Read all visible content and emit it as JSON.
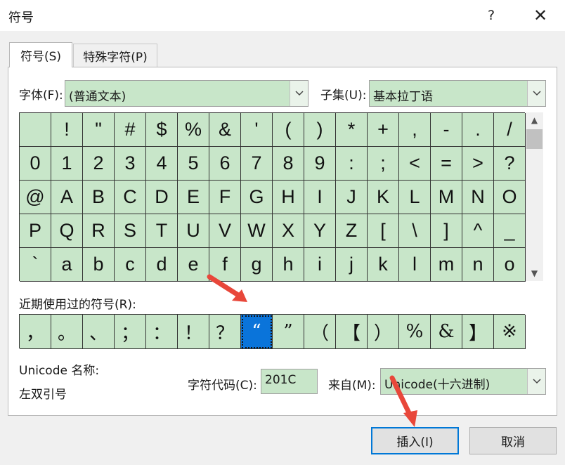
{
  "dialog": {
    "title": "符号",
    "help_glyph": "?",
    "close_glyph": "✕"
  },
  "tabs": [
    {
      "label": "符号(S)",
      "active": true
    },
    {
      "label": "特殊字符(P)",
      "active": false
    }
  ],
  "font": {
    "label": "字体(F):",
    "value": "(普通文本)"
  },
  "subset": {
    "label": "子集(U):",
    "value": "基本拉丁语"
  },
  "symbol_grid": {
    "rows": [
      [
        " ",
        "!",
        "\"",
        "#",
        "$",
        "%",
        "&",
        "'",
        "(",
        ")",
        "*",
        "+",
        ",",
        "-",
        ".",
        "/"
      ],
      [
        "0",
        "1",
        "2",
        "3",
        "4",
        "5",
        "6",
        "7",
        "8",
        "9",
        ":",
        ";",
        "<",
        "=",
        ">",
        "?"
      ],
      [
        "@",
        "A",
        "B",
        "C",
        "D",
        "E",
        "F",
        "G",
        "H",
        "I",
        "J",
        "K",
        "L",
        "M",
        "N",
        "O"
      ],
      [
        "P",
        "Q",
        "R",
        "S",
        "T",
        "U",
        "V",
        "W",
        "X",
        "Y",
        "Z",
        "[",
        "\\",
        "]",
        "^",
        "_"
      ],
      [
        "`",
        "a",
        "b",
        "c",
        "d",
        "e",
        "f",
        "g",
        "h",
        "i",
        "j",
        "k",
        "l",
        "m",
        "n",
        "o"
      ]
    ]
  },
  "recent": {
    "label": "近期使用过的符号(R):",
    "symbols": [
      "，",
      "。",
      "、",
      "；",
      "：",
      "！",
      "？",
      "“",
      "”",
      "（",
      "【",
      "）",
      "%",
      "&",
      "】",
      "※"
    ],
    "selected_index": 7
  },
  "unicode": {
    "name_label": "Unicode 名称:",
    "name_value": "左双引号"
  },
  "char_code": {
    "label": "字符代码(C):",
    "value": "201C"
  },
  "from": {
    "label": "来自(M):",
    "value": "Unicode(十六进制)"
  },
  "buttons": {
    "insert": "插入(I)",
    "cancel": "取消"
  },
  "colors": {
    "cell_bg": "#c8e6c9",
    "selected_bg": "#0a74da",
    "annotation_arrow": "#e8473a"
  }
}
